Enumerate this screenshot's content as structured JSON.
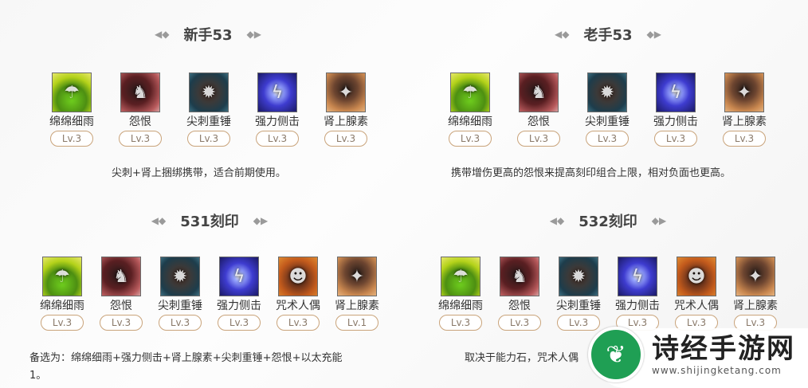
{
  "sections": [
    {
      "title": "新手53",
      "skills": [
        {
          "icon": "umbrella-rain-icon",
          "name": "绵绵细雨",
          "level": "Lv.3"
        },
        {
          "icon": "demon-beast-icon",
          "name": "怨恨",
          "level": "Lv.3"
        },
        {
          "icon": "spiked-hammer-icon",
          "name": "尖刺重锤",
          "level": "Lv.3"
        },
        {
          "icon": "lightning-strike-icon",
          "name": "强力侧击",
          "level": "Lv.3"
        },
        {
          "icon": "adrenaline-icon",
          "name": "肾上腺素",
          "level": "Lv.3"
        }
      ],
      "description": "尖刺+肾上捆绑携带，适合前期使用。"
    },
    {
      "title": "老手53",
      "skills": [
        {
          "icon": "umbrella-rain-icon",
          "name": "绵绵细雨",
          "level": "Lv.3"
        },
        {
          "icon": "demon-beast-icon",
          "name": "怨恨",
          "level": "Lv.3"
        },
        {
          "icon": "spiked-hammer-icon",
          "name": "尖刺重锤",
          "level": "Lv.3"
        },
        {
          "icon": "lightning-strike-icon",
          "name": "强力侧击",
          "level": "Lv.3"
        },
        {
          "icon": "adrenaline-icon",
          "name": "肾上腺素",
          "level": "Lv.3"
        }
      ],
      "description": "携带增伤更高的怨恨来提高刻印组合上限，相对负面也更高。"
    },
    {
      "title": "531刻印",
      "skills": [
        {
          "icon": "umbrella-rain-icon",
          "name": "绵绵细雨",
          "level": "Lv.3"
        },
        {
          "icon": "demon-beast-icon",
          "name": "怨恨",
          "level": "Lv.3"
        },
        {
          "icon": "spiked-hammer-icon",
          "name": "尖刺重锤",
          "level": "Lv.3"
        },
        {
          "icon": "lightning-strike-icon",
          "name": "强力侧击",
          "level": "Lv.3"
        },
        {
          "icon": "cursed-doll-icon",
          "name": "咒术人偶",
          "level": "Lv.3"
        },
        {
          "icon": "adrenaline-icon",
          "name": "肾上腺素",
          "level": "Lv.1"
        }
      ],
      "description_line1": "备选为：绵绵细雨+强力侧击+肾上腺素+尖刺重锤+怨恨+以太充能",
      "description_line2": "1。"
    },
    {
      "title": "532刻印",
      "skills": [
        {
          "icon": "umbrella-rain-icon",
          "name": "绵绵细雨",
          "level": "Lv.3"
        },
        {
          "icon": "demon-beast-icon",
          "name": "怨恨",
          "level": "Lv.3"
        },
        {
          "icon": "spiked-hammer-icon",
          "name": "尖刺重锤",
          "level": "Lv.3"
        },
        {
          "icon": "lightning-strike-icon",
          "name": "强力侧击",
          "level": "Lv.3"
        },
        {
          "icon": "cursed-doll-icon",
          "name": "咒术人偶",
          "level": "Lv.3"
        },
        {
          "icon": "adrenaline-icon",
          "name": "肾上腺素",
          "level": "Lv.3"
        }
      ],
      "description": "取决于能力石，咒术人偶"
    }
  ],
  "watermark": {
    "title": "诗经手游网",
    "url": "www.shijingketang.com"
  }
}
